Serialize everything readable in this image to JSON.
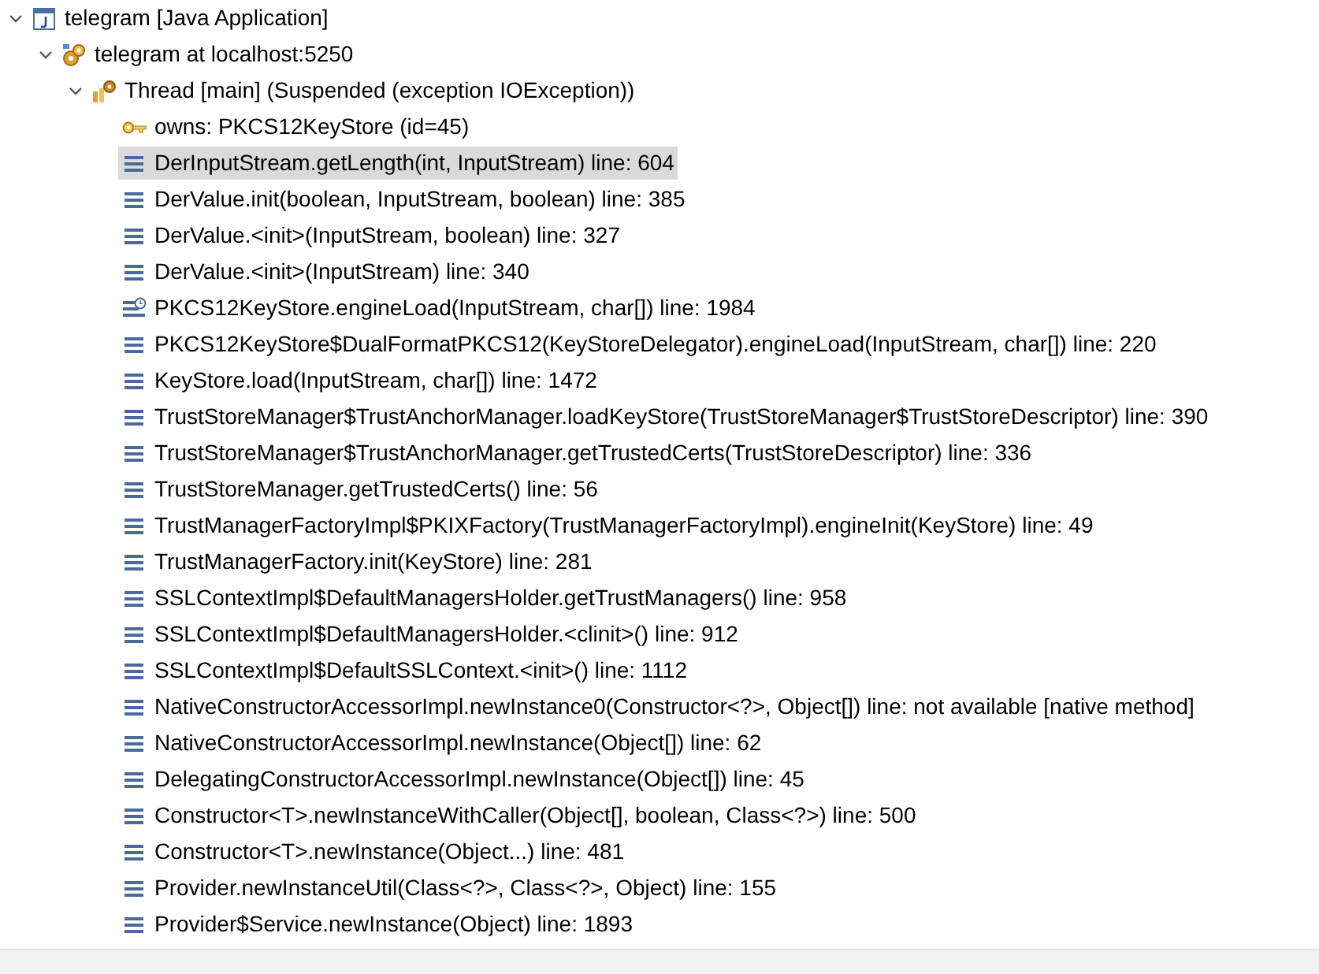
{
  "tree": [
    {
      "kind": "launch",
      "label": "telegram [Java Application]",
      "expanded": true,
      "selected": false,
      "children": [
        {
          "kind": "target",
          "label": "telegram at localhost:5250",
          "expanded": true,
          "selected": false,
          "children": [
            {
              "kind": "thread",
              "label": "Thread [main] (Suspended (exception IOException))",
              "expanded": true,
              "selected": false,
              "children": [
                {
                  "kind": "monitor",
                  "label": "owns: PKCS12KeyStore  (id=45)",
                  "selected": false
                },
                {
                  "kind": "frame",
                  "label": "DerInputStream.getLength(int, InputStream) line: 604",
                  "selected": true
                },
                {
                  "kind": "frame",
                  "label": "DerValue.init(boolean, InputStream, boolean) line: 385",
                  "selected": false
                },
                {
                  "kind": "frame",
                  "label": "DerValue.<init>(InputStream, boolean) line: 327",
                  "selected": false
                },
                {
                  "kind": "frame",
                  "label": "DerValue.<init>(InputStream) line: 340",
                  "selected": false
                },
                {
                  "kind": "frame-marked",
                  "label": "PKCS12KeyStore.engineLoad(InputStream, char[]) line: 1984",
                  "selected": false
                },
                {
                  "kind": "frame",
                  "label": "PKCS12KeyStore$DualFormatPKCS12(KeyStoreDelegator).engineLoad(InputStream, char[]) line: 220",
                  "selected": false
                },
                {
                  "kind": "frame",
                  "label": "KeyStore.load(InputStream, char[]) line: 1472",
                  "selected": false
                },
                {
                  "kind": "frame",
                  "label": "TrustStoreManager$TrustAnchorManager.loadKeyStore(TrustStoreManager$TrustStoreDescriptor) line: 390",
                  "selected": false
                },
                {
                  "kind": "frame",
                  "label": "TrustStoreManager$TrustAnchorManager.getTrustedCerts(TrustStoreDescriptor) line: 336",
                  "selected": false
                },
                {
                  "kind": "frame",
                  "label": "TrustStoreManager.getTrustedCerts() line: 56",
                  "selected": false
                },
                {
                  "kind": "frame",
                  "label": "TrustManagerFactoryImpl$PKIXFactory(TrustManagerFactoryImpl).engineInit(KeyStore) line: 49",
                  "selected": false
                },
                {
                  "kind": "frame",
                  "label": "TrustManagerFactory.init(KeyStore) line: 281",
                  "selected": false
                },
                {
                  "kind": "frame",
                  "label": "SSLContextImpl$DefaultManagersHolder.getTrustManagers() line: 958",
                  "selected": false
                },
                {
                  "kind": "frame",
                  "label": "SSLContextImpl$DefaultManagersHolder.<clinit>() line: 912",
                  "selected": false
                },
                {
                  "kind": "frame",
                  "label": "SSLContextImpl$DefaultSSLContext.<init>() line: 1112",
                  "selected": false
                },
                {
                  "kind": "frame",
                  "label": "NativeConstructorAccessorImpl.newInstance0(Constructor<?>, Object[]) line: not available [native method]",
                  "selected": false
                },
                {
                  "kind": "frame",
                  "label": "NativeConstructorAccessorImpl.newInstance(Object[]) line: 62",
                  "selected": false
                },
                {
                  "kind": "frame",
                  "label": "DelegatingConstructorAccessorImpl.newInstance(Object[]) line: 45",
                  "selected": false
                },
                {
                  "kind": "frame",
                  "label": "Constructor<T>.newInstanceWithCaller(Object[], boolean, Class<?>) line: 500",
                  "selected": false
                },
                {
                  "kind": "frame",
                  "label": "Constructor<T>.newInstance(Object...) line: 481",
                  "selected": false
                },
                {
                  "kind": "frame",
                  "label": "Provider.newInstanceUtil(Class<?>, Class<?>, Object) line: 155",
                  "selected": false
                },
                {
                  "kind": "frame",
                  "label": "Provider$Service.newInstance(Object) line: 1893",
                  "selected": false
                }
              ]
            }
          ]
        }
      ]
    }
  ]
}
